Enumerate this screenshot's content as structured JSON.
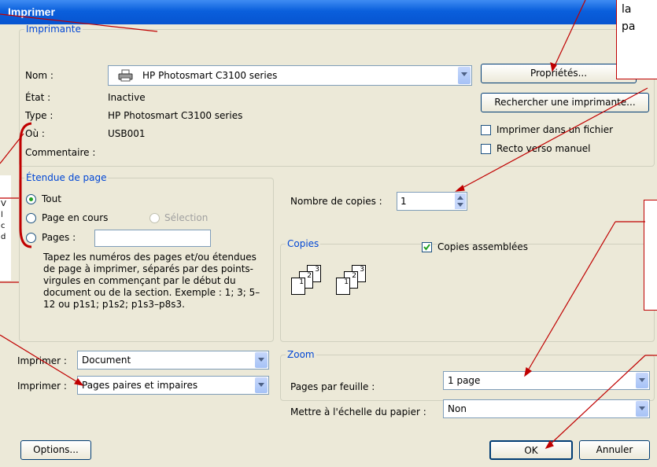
{
  "window": {
    "title": "Imprimer",
    "help_label": "?"
  },
  "printer": {
    "legend": "Imprimante",
    "name_label": "Nom :",
    "name_value": "HP Photosmart C3100 series",
    "state_label": "État :",
    "state_value": "Inactive",
    "type_label": "Type :",
    "type_value": "HP Photosmart C3100 series",
    "where_label": "Où :",
    "where_value": "USB001",
    "comment_label": "Commentaire :",
    "properties_button": "Propriétés...",
    "find_button": "Rechercher une imprimante...",
    "print_to_file": "Imprimer dans un fichier",
    "manual_duplex": "Recto verso manuel"
  },
  "page_range": {
    "legend": "Étendue de page",
    "all": "Tout",
    "current": "Page en cours",
    "selection": "Sélection",
    "pages": "Pages :",
    "pages_value": "",
    "hint": "Tapez les numéros des pages et/ou étendues de page à imprimer, séparés par des points-virgules en commençant par le début du document ou de la section. Exemple : 1; 3; 5–12 ou p1s1; p1s2; p1s3–p8s3."
  },
  "copies": {
    "legend": "Copies",
    "count_label": "Nombre de copies :",
    "count_value": "1",
    "collate": "Copies assemblées",
    "stack_pages": [
      "3",
      "2",
      "1"
    ]
  },
  "print_what": {
    "label1": "Imprimer :",
    "value1": "Document",
    "label2": "Imprimer :",
    "value2": "Pages paires et impaires"
  },
  "zoom": {
    "legend": "Zoom",
    "pages_label": "Pages par feuille :",
    "pages_value": "1 page",
    "scale_label": "Mettre à l'échelle du papier :",
    "scale_value": "Non"
  },
  "footer": {
    "options_button": "Options...",
    "ok_button": "OK",
    "cancel_button": "Annuler"
  },
  "annotations": {
    "top_right_text": "la\npa",
    "left_text": "V\nl\nc\nd"
  },
  "colors": {
    "annotation": "#c00000",
    "titlebar": "#0a5fdc",
    "group_title": "#0046d5"
  }
}
